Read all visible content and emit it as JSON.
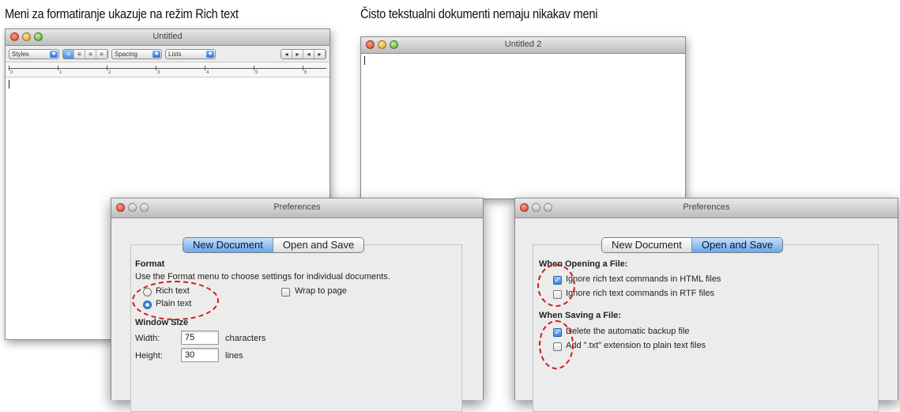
{
  "captions": {
    "left": "Meni za formatiranje ukazuje na režim Rich text",
    "right": "Čisto tekstualni dokumenti nemaju nikakav meni"
  },
  "rich_window": {
    "title": "Untitled",
    "toolbar": {
      "styles": "Styles",
      "spacing": "Spacing",
      "lists": "Lists",
      "align_icons": [
        "align-left-icon",
        "align-center-icon",
        "align-justify-icon",
        "align-right-icon"
      ]
    },
    "ruler_numbers": [
      "0",
      "1",
      "2",
      "3",
      "4",
      "5",
      "6"
    ]
  },
  "plain_window": {
    "title": "Untitled 2"
  },
  "prefs_left": {
    "title": "Preferences",
    "tabs": [
      "New Document",
      "Open and Save"
    ],
    "active_tab": "New Document",
    "format_heading": "Format",
    "format_desc": "Use the Format menu to choose settings for individual documents.",
    "rich_text": "Rich text",
    "plain_text": "Plain text",
    "wrap_to_page": "Wrap to page",
    "window_size_heading": "Window Size",
    "width_label": "Width:",
    "width_value": "75",
    "width_unit": "characters",
    "height_label": "Height:",
    "height_value": "30",
    "height_unit": "lines",
    "selected_format": "Plain text"
  },
  "prefs_right": {
    "title": "Preferences",
    "tabs": [
      "New Document",
      "Open and Save"
    ],
    "active_tab": "Open and Save",
    "opening_heading": "When Opening a File:",
    "ignore_html": "Ignore rich text commands in HTML files",
    "ignore_rtf": "Ignore rich text commands in RTF files",
    "saving_heading": "When Saving a File:",
    "delete_backup": "Delete the automatic backup file",
    "add_txt": "Add \".txt\" extension to plain text files",
    "checked": {
      "ignore_html": true,
      "ignore_rtf": false,
      "delete_backup": true,
      "add_txt": false
    }
  },
  "colors": {
    "highlight_ring": "#d11a1a",
    "selection_blue": "#4d8fe0"
  }
}
